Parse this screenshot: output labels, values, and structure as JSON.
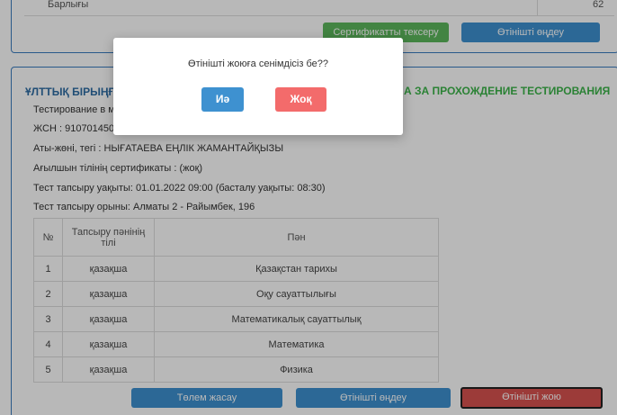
{
  "top": {
    "total_label": "Барлығы",
    "total_value": "62",
    "check_cert_button": "Сертификатты тексеру",
    "edit_app_button": "Өтінішті өңдеу"
  },
  "main": {
    "title_left": "ҰЛТТЫҚ БІРЫҢҒ",
    "title_right": "А ЗА ПРОХОЖДЕНИЕ ТЕСТИРОВАНИЯ",
    "testing_line": "Тестирование в м",
    "iin_line": "ЖСН : 9107014507",
    "name_line": "Аты-жөні, тегі : НЫҒАТАЕВА ЕҢЛІК ЖАМАНТАЙҚЫЗЫ",
    "english_cert_line": "Ағылшын тілінің сертификаты : (жоқ)",
    "test_time_line": "Тест тапсыру уақыты: 01.01.2022 09:00 (басталу уақыты: 08:30)",
    "test_place_line": "Тест тапсыру орыны: Алматы 2 - Райымбек, 196",
    "table": {
      "headers": {
        "num": "№",
        "lang": "Тапсыру пәнінің тілі",
        "subject": "Пән"
      },
      "rows": [
        {
          "num": "1",
          "lang": "қазақша",
          "subject": "Қазақстан тарихы"
        },
        {
          "num": "2",
          "lang": "қазақша",
          "subject": "Оқу сауаттылығы"
        },
        {
          "num": "3",
          "lang": "қазақша",
          "subject": "Математикалық сауаттылық"
        },
        {
          "num": "4",
          "lang": "қазақша",
          "subject": "Математика"
        },
        {
          "num": "5",
          "lang": "қазақша",
          "subject": "Физика"
        }
      ]
    },
    "pay_button": "Төлем жасау",
    "edit_button": "Өтінішті өңдеу",
    "delete_button": "Өтінішті жою"
  },
  "dialog": {
    "message": "Өтінішті жоюға сенімдісіз бе??",
    "yes_button": "Иә",
    "no_button": "Жоқ"
  },
  "colors": {
    "primary": "#3e91d0",
    "success": "#5cb85c",
    "danger": "#d9534f",
    "dialog_no": "#f36b6b",
    "title_blue": "#2e6da4",
    "title_green": "#3cb54a"
  }
}
